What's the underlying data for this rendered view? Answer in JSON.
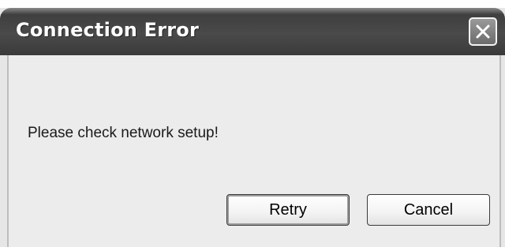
{
  "window": {
    "title": "Connection Error"
  },
  "titlebar": {
    "close_icon": "close-icon"
  },
  "content": {
    "message": "Please check network setup!"
  },
  "buttons": {
    "retry_label": "Retry",
    "cancel_label": "Cancel"
  },
  "colors": {
    "titlebar": "#3f3f3f",
    "dialog_background": "#ececec",
    "title_text": "#ffffff"
  }
}
